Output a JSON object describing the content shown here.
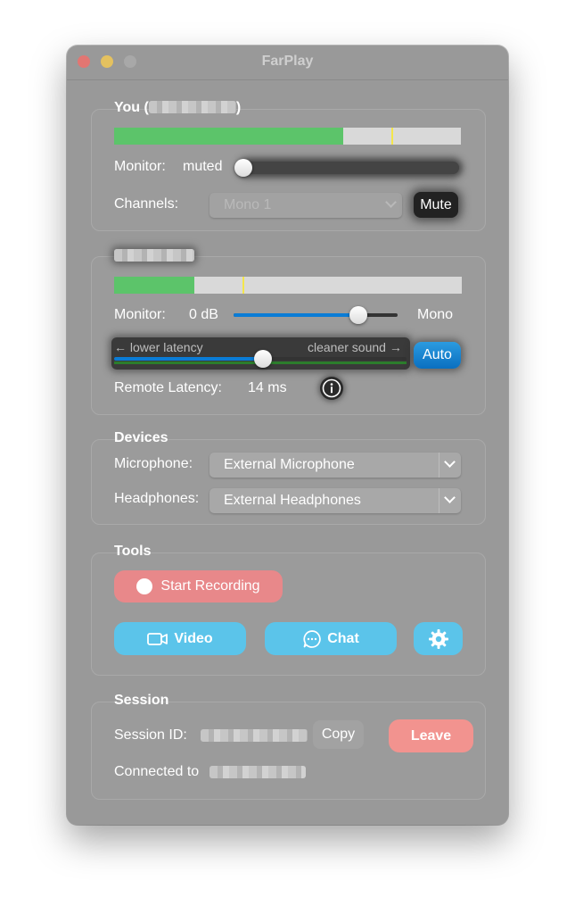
{
  "window": {
    "title": "FarPlay"
  },
  "you": {
    "title_prefix": "You (",
    "title_suffix": ")",
    "meter_level": 0.66,
    "meter_peak": 0.8,
    "monitor_label": "Monitor:",
    "monitor_value": "muted",
    "channels_label": "Channels:",
    "channels_value": "Mono 1",
    "mute_label": "Mute"
  },
  "remote": {
    "meter_level": 0.23,
    "meter_peak": 0.37,
    "monitor_label": "Monitor:",
    "monitor_value": "0 dB",
    "monitor_slider": 0.76,
    "mono_label": "Mono",
    "lower_latency": "← lower latency",
    "cleaner_sound": "cleaner sound →",
    "latency_slider": 0.51,
    "auto_label": "Auto",
    "remote_latency_label": "Remote Latency:",
    "remote_latency_value": "14 ms"
  },
  "devices": {
    "title": "Devices",
    "microphone_label": "Microphone:",
    "microphone_value": "External Microphone",
    "headphones_label": "Headphones:",
    "headphones_value": "External Headphones"
  },
  "tools": {
    "title": "Tools",
    "start_recording": "Start Recording",
    "video": "Video",
    "chat": "Chat"
  },
  "session": {
    "title": "Session",
    "session_id_label": "Session ID:",
    "copy_label": "Copy",
    "leave_label": "Leave",
    "connected_to_label": "Connected to"
  },
  "colors": {
    "window_bg": "#999999",
    "meter_green": "#5cc46a",
    "peak_yellow": "#f4e64b",
    "accent_blue": "#0a7cd6",
    "record_red": "#e8888a",
    "tool_blue": "#5bc4ea",
    "leave_red": "#f2938f"
  },
  "icons": [
    "record-dot-icon",
    "video-camera-icon",
    "chat-bubble-icon",
    "gear-icon",
    "info-icon",
    "chevron-down-icon"
  ]
}
